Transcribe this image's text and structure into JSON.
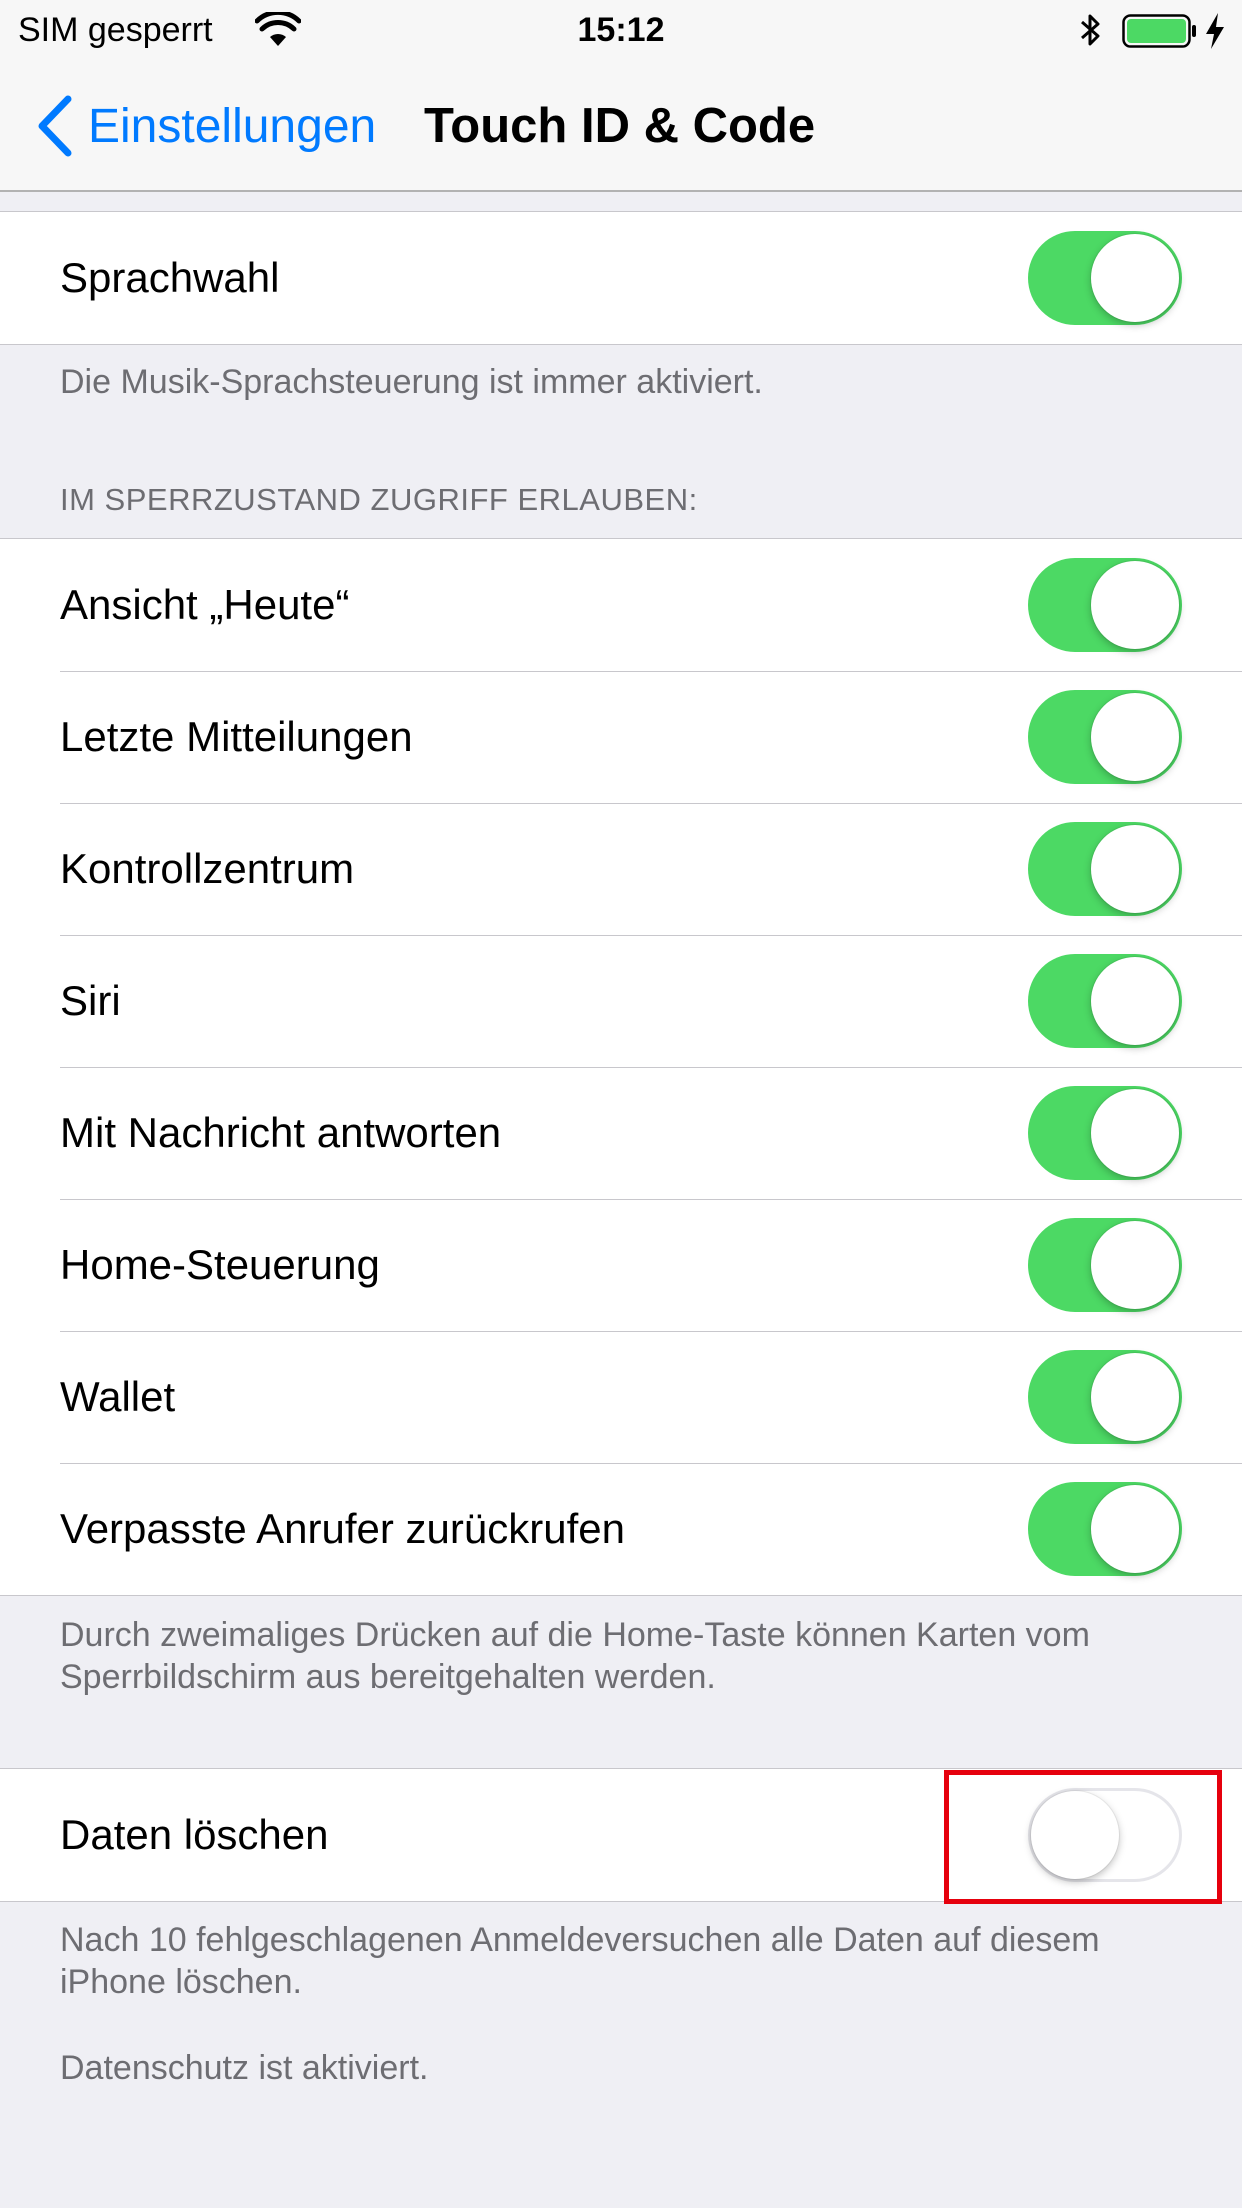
{
  "status_bar": {
    "carrier": "SIM gesperrt",
    "time": "15:12",
    "icons": [
      "wifi-icon",
      "bluetooth-icon",
      "battery-icon",
      "charging-bolt-icon"
    ],
    "battery_color": "#4cd964"
  },
  "nav": {
    "back_label": "Einstellungen",
    "title": "Touch ID & Code",
    "accent_color": "#007aff"
  },
  "voice_dial": {
    "label": "Sprachwahl",
    "on": true,
    "footer": "Die Musik-Sprachsteuerung ist immer aktiviert."
  },
  "lock_access": {
    "header": "IM SPERRZUSTAND ZUGRIFF ERLAUBEN:",
    "items": [
      {
        "label": "Ansicht „Heute“",
        "on": true
      },
      {
        "label": "Letzte Mitteilungen",
        "on": true
      },
      {
        "label": "Kontrollzentrum",
        "on": true
      },
      {
        "label": "Siri",
        "on": true
      },
      {
        "label": "Mit Nachricht antworten",
        "on": true
      },
      {
        "label": "Home-Steuerung",
        "on": true
      },
      {
        "label": "Wallet",
        "on": true
      },
      {
        "label": "Verpasste Anrufer zurückrufen",
        "on": true
      }
    ],
    "footer": "Durch zweimaliges Drücken auf die Home-Taste können Karten vom Sperrbildschirm aus bereitgehalten werden."
  },
  "erase_data": {
    "label": "Daten löschen",
    "on": false,
    "footer": "Nach 10 fehlgeschlagenen Anmeldeversuchen alle Daten auf diesem iPhone löschen.",
    "footer2": "Datenschutz ist aktiviert."
  },
  "colors": {
    "toggle_on": "#4cd964",
    "highlight": "#e6000d"
  }
}
